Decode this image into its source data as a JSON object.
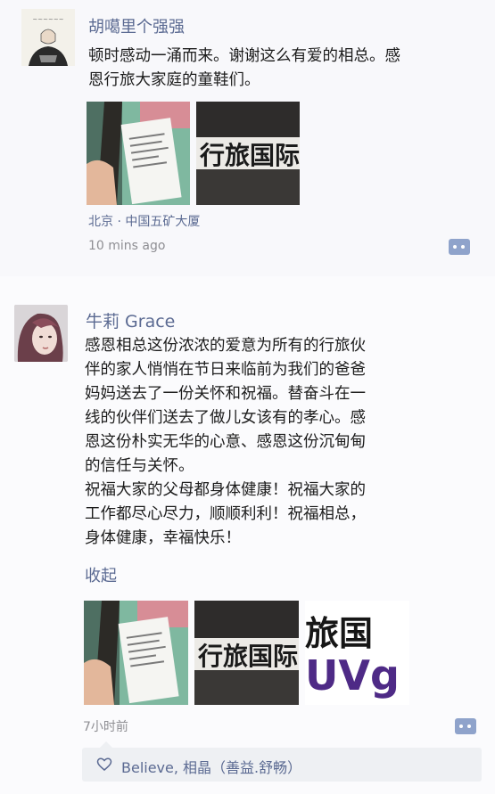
{
  "posts": [
    {
      "author": "胡噶里个强强",
      "text_lines": [
        "顿时感动一涌而来。谢谢这么有爱的相总。感",
        "恩行旅大家庭的童鞋们。"
      ],
      "location": "北京 · 中国五矿大厦",
      "time": "10 mins ago",
      "photos": [
        {
          "icon": "hand-holding-card-photo"
        },
        {
          "icon": "company-sign-photo",
          "sign_text": "行旅国际"
        }
      ]
    },
    {
      "author": "牛莉 Grace",
      "text_lines": [
        "感恩相总这份浓浓的爱意为所有的行旅伙",
        "伴的家人悄悄在节日来临前为我们的爸爸",
        "妈妈送去了一份关怀和祝福。替奋斗在一",
        "线的伙伴们送去了做儿女该有的孝心。感",
        "恩这份朴实无华的心意、感恩这份沉甸甸",
        "的信任与关怀。",
        "祝福大家的父母都身体健康！祝福大家的",
        "工作都尽心尽力，顺顺利利！祝福相总，",
        "身体健康，幸福快乐！"
      ],
      "collapse_label": "收起",
      "time": "7小时前",
      "photos": [
        {
          "icon": "hand-holding-card-photo"
        },
        {
          "icon": "company-sign-photo",
          "sign_text": "行旅国际"
        },
        {
          "icon": "company-logo-photo",
          "sign_text": "旅国",
          "logo_text": "UVg"
        }
      ],
      "likes": "Believe, 相晶（善益.舒畅）"
    }
  ],
  "colors": {
    "name_link": "#5b6a92",
    "comment_button": "#8fa3cb",
    "likes_bg": "#eef0f3"
  }
}
